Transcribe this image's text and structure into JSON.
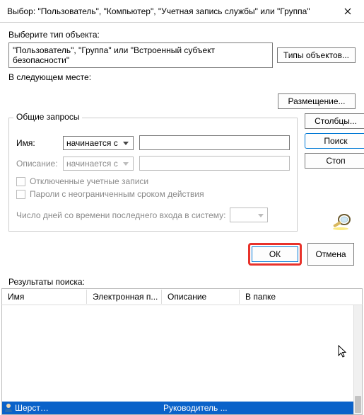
{
  "titlebar": {
    "title": "Выбор: \"Пользователь\", \"Компьютер\", \"Учетная запись службы\" или \"Группа\""
  },
  "object_type": {
    "label": "Выберите тип объекта:",
    "value": "\"Пользователь\", \"Группа\" или \"Встроенный субъект безопасности\"",
    "button": "Типы объектов..."
  },
  "location": {
    "label": "В следующем месте:",
    "button": "Размещение..."
  },
  "queries": {
    "legend": "Общие запросы",
    "name_label": "Имя:",
    "name_match": "начинается с",
    "desc_label": "Описание:",
    "desc_match": "начинается с",
    "cb_disabled": "Отключенные учетные записи",
    "cb_nonexpire": "Пароли с неограниченным сроком действия",
    "days_label": "Число дней со времени последнего входа в систему:",
    "columns_btn": "Столбцы...",
    "search_btn": "Поиск",
    "stop_btn": "Стоп"
  },
  "actions": {
    "ok": "ОК",
    "cancel": "Отмена"
  },
  "results": {
    "label": "Результаты поиска:",
    "columns": [
      "Имя",
      "Электронная п...",
      "Описание",
      "В папке"
    ],
    "selected": {
      "name": "Шерст…",
      "desc": "Руководитель ..."
    }
  }
}
